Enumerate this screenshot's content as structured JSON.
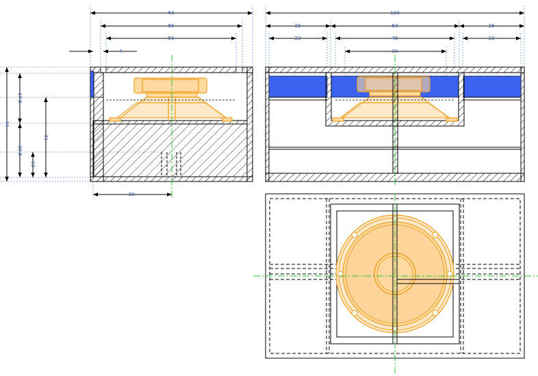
{
  "drawing": {
    "colors": {
      "outline": "#000000",
      "hatch": "#000000",
      "dimension_line": "#000000",
      "dimension_text": "#3b5bb5",
      "guide_line": "#3b6fd4",
      "center_line": "#2fbf2f",
      "speaker_outline": "#f0a020",
      "speaker_fill": "#ffd9a0",
      "speaker_cone_fill": "#fde9c8",
      "port_fill": "#3b63f0"
    },
    "side_view": {
      "dims_horizontal": {
        "overall": "63",
        "inner": "55",
        "baffle": "50",
        "wall": "4",
        "center": "30"
      },
      "dims_vertical": {
        "overall": "44",
        "upper": "17.5",
        "height": "31",
        "lower": "20.5",
        "small": "10"
      }
    },
    "front_view": {
      "dims_horizontal": {
        "overall": "100",
        "left": "25",
        "center": "50",
        "right": "25",
        "left_inner": "22",
        "center_inner": "45",
        "right_inner": "22",
        "cutout": "39"
      }
    },
    "top_view": {
      "speaker_icon": "loudspeaker-driver"
    }
  }
}
